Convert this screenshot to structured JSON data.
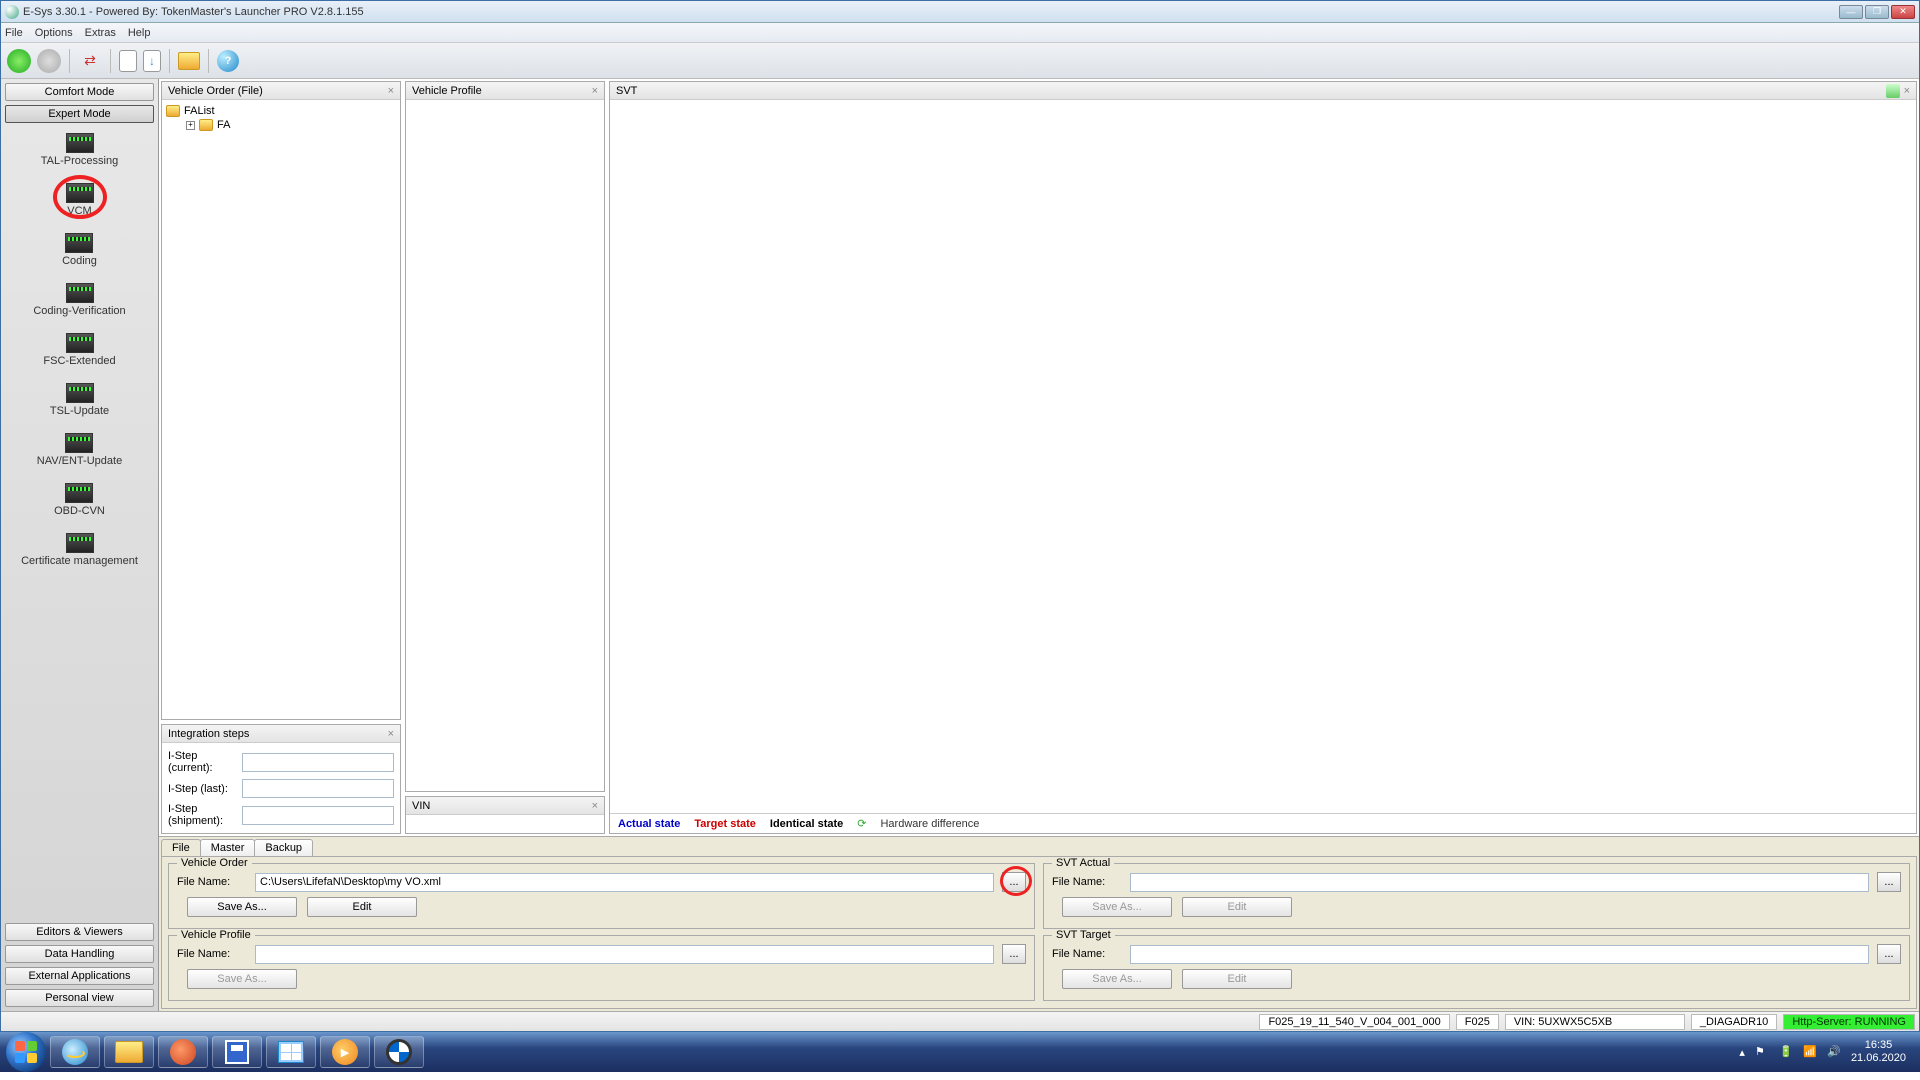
{
  "titlebar": {
    "title": "E-Sys 3.30.1 - Powered By: TokenMaster's Launcher PRO V2.8.1.155"
  },
  "menu": {
    "file": "File",
    "options": "Options",
    "extras": "Extras",
    "help": "Help"
  },
  "modes": {
    "comfort": "Comfort Mode",
    "expert": "Expert Mode"
  },
  "tools": {
    "tal": "TAL-Processing",
    "vcm": "VCM",
    "coding": "Coding",
    "coding_ver": "Coding-Verification",
    "fsc": "FSC-Extended",
    "tsl": "TSL-Update",
    "nav": "NAV/ENT-Update",
    "obd": "OBD-CVN",
    "cert": "Certificate management"
  },
  "left_bottom": {
    "ev": "Editors & Viewers",
    "dh": "Data Handling",
    "ea": "External Applications",
    "pv": "Personal view"
  },
  "panels": {
    "vo_file": "Vehicle Order (File)",
    "vehicle_profile": "Vehicle Profile",
    "svt": "SVT",
    "vin": "VIN",
    "integration": "Integration steps"
  },
  "tree": {
    "falist": "FAList",
    "fa": "FA"
  },
  "integration": {
    "current": "I-Step (current):",
    "last": "I-Step (last):",
    "shipment": "I-Step (shipment):",
    "current_val": "",
    "last_val": "",
    "shipment_val": ""
  },
  "svt_status": {
    "actual": "Actual state",
    "target": "Target state",
    "identical": "Identical state",
    "hw": "Hardware difference"
  },
  "tabs": {
    "file": "File",
    "master": "Master",
    "backup": "Backup"
  },
  "vo_form": {
    "legend": "Vehicle Order",
    "filename_label": "File Name:",
    "filename": "C:\\Users\\LifefaN\\Desktop\\my VO.xml",
    "save_as": "Save As...",
    "edit": "Edit"
  },
  "vp_form": {
    "legend": "Vehicle Profile",
    "filename_label": "File Name:",
    "filename": "",
    "save_as": "Save As..."
  },
  "svt_actual": {
    "legend": "SVT Actual",
    "filename_label": "File Name:",
    "filename": "",
    "save_as": "Save As...",
    "edit": "Edit"
  },
  "svt_target": {
    "legend": "SVT Target",
    "filename_label": "File Name:",
    "filename": "",
    "save_as": "Save As...",
    "edit": "Edit"
  },
  "status": {
    "build": "F025_19_11_540_V_004_001_000",
    "chassis": "F025",
    "vin": "VIN: 5UXWX5C5XB",
    "diag": "_DIAGADR10",
    "server": "Http-Server: RUNNING"
  },
  "browse": "...",
  "clock": {
    "time": "16:35",
    "date": "21.06.2020"
  }
}
